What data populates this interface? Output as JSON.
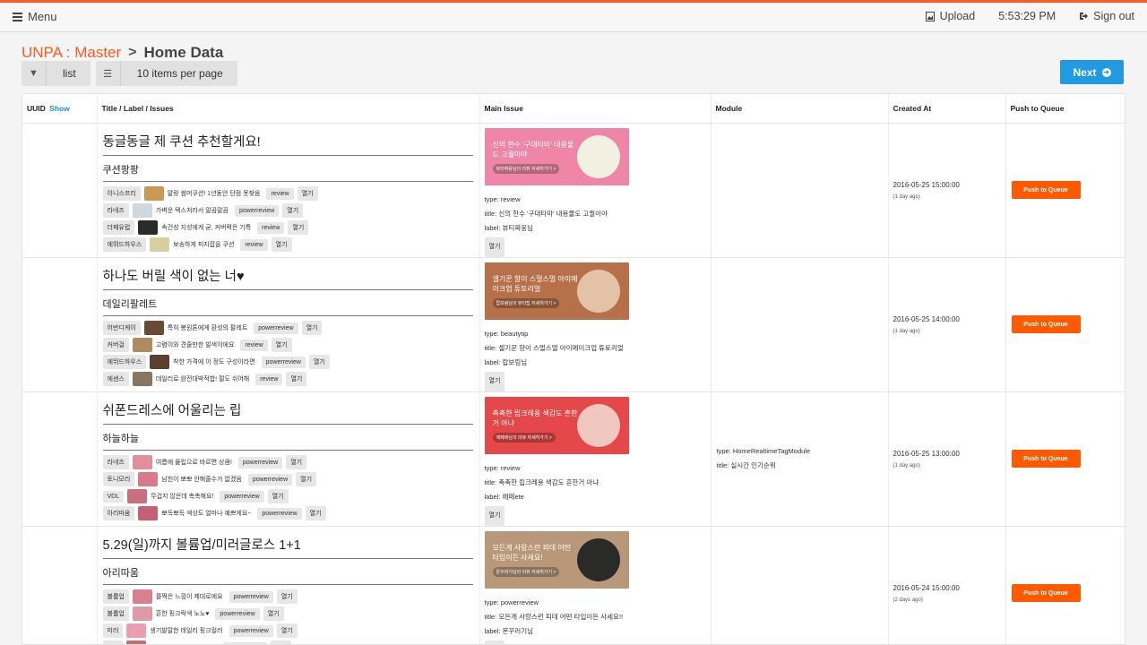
{
  "topbar": {
    "menu_label": "Menu",
    "upload_label": "Upload",
    "time": "5:53:29 PM",
    "signout_label": "Sign out"
  },
  "breadcrumb": {
    "root": "UNPA : Master",
    "sep": ">",
    "current": "Home Data"
  },
  "toolbar": {
    "list_label": "list",
    "per_page_label": "10 items per page",
    "next_label": "Next"
  },
  "table": {
    "headers": {
      "uuid": "UUID",
      "uuid_show": "Show",
      "title": "Title / Label / Issues",
      "main_issue": "Main Issue",
      "module": "Module",
      "created": "Created At",
      "push": "Push to Queue"
    },
    "push_label": "Push to Queue",
    "rows": [
      {
        "title": "동글동글 제 쿠션 추천할게요!",
        "label": "쿠션팡팡",
        "issues": [
          {
            "brand": "이니스프리",
            "title": "말랑 썸머쿠션! 1년동안 단점 못찾음",
            "type": "review",
            "open": "열기",
            "color": "#c89a55"
          },
          {
            "brand": "라네즈",
            "title": "가벼운 텍스처라서 말끔말끔",
            "type": "powerreview",
            "open": "열기",
            "color": "#cfd7df"
          },
          {
            "brand": "더페유럽",
            "title": "속건성 지성에게 굳, 커버력은 기특",
            "type": "review",
            "open": "열기",
            "color": "#2a2a2a"
          },
          {
            "brand": "에뛰드하우스",
            "title": "보송하게 피지잡을 쿠션",
            "type": "review",
            "open": "열기",
            "color": "#d8cfa0"
          }
        ],
        "main": {
          "banner_text": "신의 한수 '구대타마' 내용물도 고퀄이야",
          "banner_sub": "뷰티짜웅님의 리뷰 자세히가기 >",
          "bg": "#ef86a8",
          "art": "#f2f0e0",
          "type": "type: review",
          "title": "title: 신의 한수 '구대타마' 내용물도 고퀄이야",
          "label": "label: 뷰티짜웅님",
          "open": "열기"
        },
        "module_type": "",
        "module_title": "",
        "created": "2016-05-25 15:00:00",
        "ago": "(1 day ago)"
      },
      {
        "title": "하나도 버릴 색이 없는 너♥",
        "label": "데일리팔레트",
        "issues": [
          {
            "brand": "어반디케이",
            "title": "특히 봉원톤에게 환성의 팔레트",
            "type": "powerreview",
            "open": "열기",
            "color": "#6b4a35"
          },
          {
            "brand": "커버걸",
            "title": "고렴이와 견줄만한 발색이에요",
            "type": "review",
            "open": "열기",
            "color": "#b08a60"
          },
          {
            "brand": "에뛰드하우스",
            "title": "착한 가격에 이 정도 구성이라면",
            "type": "powerreview",
            "open": "열기",
            "color": "#5a4030"
          },
          {
            "brand": "에센스",
            "title": "데일리로 완전대박적합! 펄도 쉬어해",
            "type": "review",
            "open": "열기",
            "color": "#8a7560"
          }
        ],
        "main": {
          "banner_text": "셀기꾼 향이 스멀스멀 아이메이크업 튜토리얼",
          "banner_sub": "랍보림님의 뷰티팁 자세히가기 >",
          "bg": "#b6704a",
          "art": "#e4c2a8",
          "type": "type: beautytip",
          "title": "title: 셀기꾼 향이 스멀스멀 아이메이크업 튜토리얼",
          "label": "label: 랍보림님",
          "open": "열기"
        },
        "module_type": "",
        "module_title": "",
        "created": "2016-05-25 14:00:00",
        "ago": "(1 day ago)"
      },
      {
        "title": "쉬폰드레스에 어울리는 립",
        "label": "하늘하늘",
        "issues": [
          {
            "brand": "라네즈",
            "title": "여름에 물립으로 바르면 상큼!",
            "type": "powerreview",
            "open": "열기",
            "color": "#e0909a"
          },
          {
            "brand": "토니모리",
            "title": "남친이 뽀뽀 안해줄수가 없겠음",
            "type": "powerreview",
            "open": "열기",
            "color": "#d87a8a"
          },
          {
            "brand": "VDL",
            "title": "무겁지 않은데 촉촉해요!",
            "type": "powerreview",
            "open": "열기",
            "color": "#c97080"
          },
          {
            "brand": "아리따움",
            "title": "뽀득뽀득 색상도 얼마나 예쁘게요~",
            "type": "powerreview",
            "open": "열기",
            "color": "#c46075"
          }
        ],
        "main": {
          "banner_text": "촉촉한 립크레용 색감도 흔한거 아냐",
          "banner_sub": "에페에님의 리뷰 자세히가기 >",
          "bg": "#e54848",
          "art": "#f0c8c0",
          "type": "type: review",
          "title": "title: 촉촉한 립크레용 색감도 흔한거 아냐",
          "label": "label: 에페ete",
          "open": "열기"
        },
        "module_type": "type: HomeRealtimeTagModule",
        "module_title": "title: 실시간 인기순위",
        "created": "2016-05-25 13:00:00",
        "ago": "(1 day ago)"
      },
      {
        "title": "5.29(일)까지 볼륨업/미러글로스 1+1",
        "label": "아리따움",
        "issues": [
          {
            "brand": "볼륨업",
            "title": "쫄쩍은 느낌이 제대로에요",
            "type": "powerreview",
            "open": "열기",
            "color": "#d88090"
          },
          {
            "brand": "볼륨업",
            "title": "흔한 핑크락색 노노♥",
            "type": "powerreview",
            "open": "열기",
            "color": "#e09aa5"
          },
          {
            "brand": "미러",
            "title": "생기발랄한 데일리 핑크컬러",
            "type": "powerreview",
            "open": "열기",
            "color": "#e8a0b0"
          },
          {
            "brand": "미러",
            "title": "원톤의 데일리로 최고일듯",
            "type": "powerreview",
            "open": "열기",
            "color": "#c86a70"
          }
        ],
        "main": {
          "banner_text": "모든게 사랑스런 피데 어떤 타입이든 사세요!",
          "banner_sub": "몬꾸러기님의 리뷰 자세히가기 >",
          "bg": "#b89878",
          "art": "#2a2a28",
          "type": "type: powerreview",
          "title": "title: 모든게 사랑스런 피데 어떤 타입이든 사세요!!",
          "label": "label: 몬꾸러기님",
          "open": "열기"
        },
        "module_type": "",
        "module_title": "",
        "created": "2016-05-24 15:00:00",
        "ago": "(2 days ago)"
      }
    ]
  }
}
